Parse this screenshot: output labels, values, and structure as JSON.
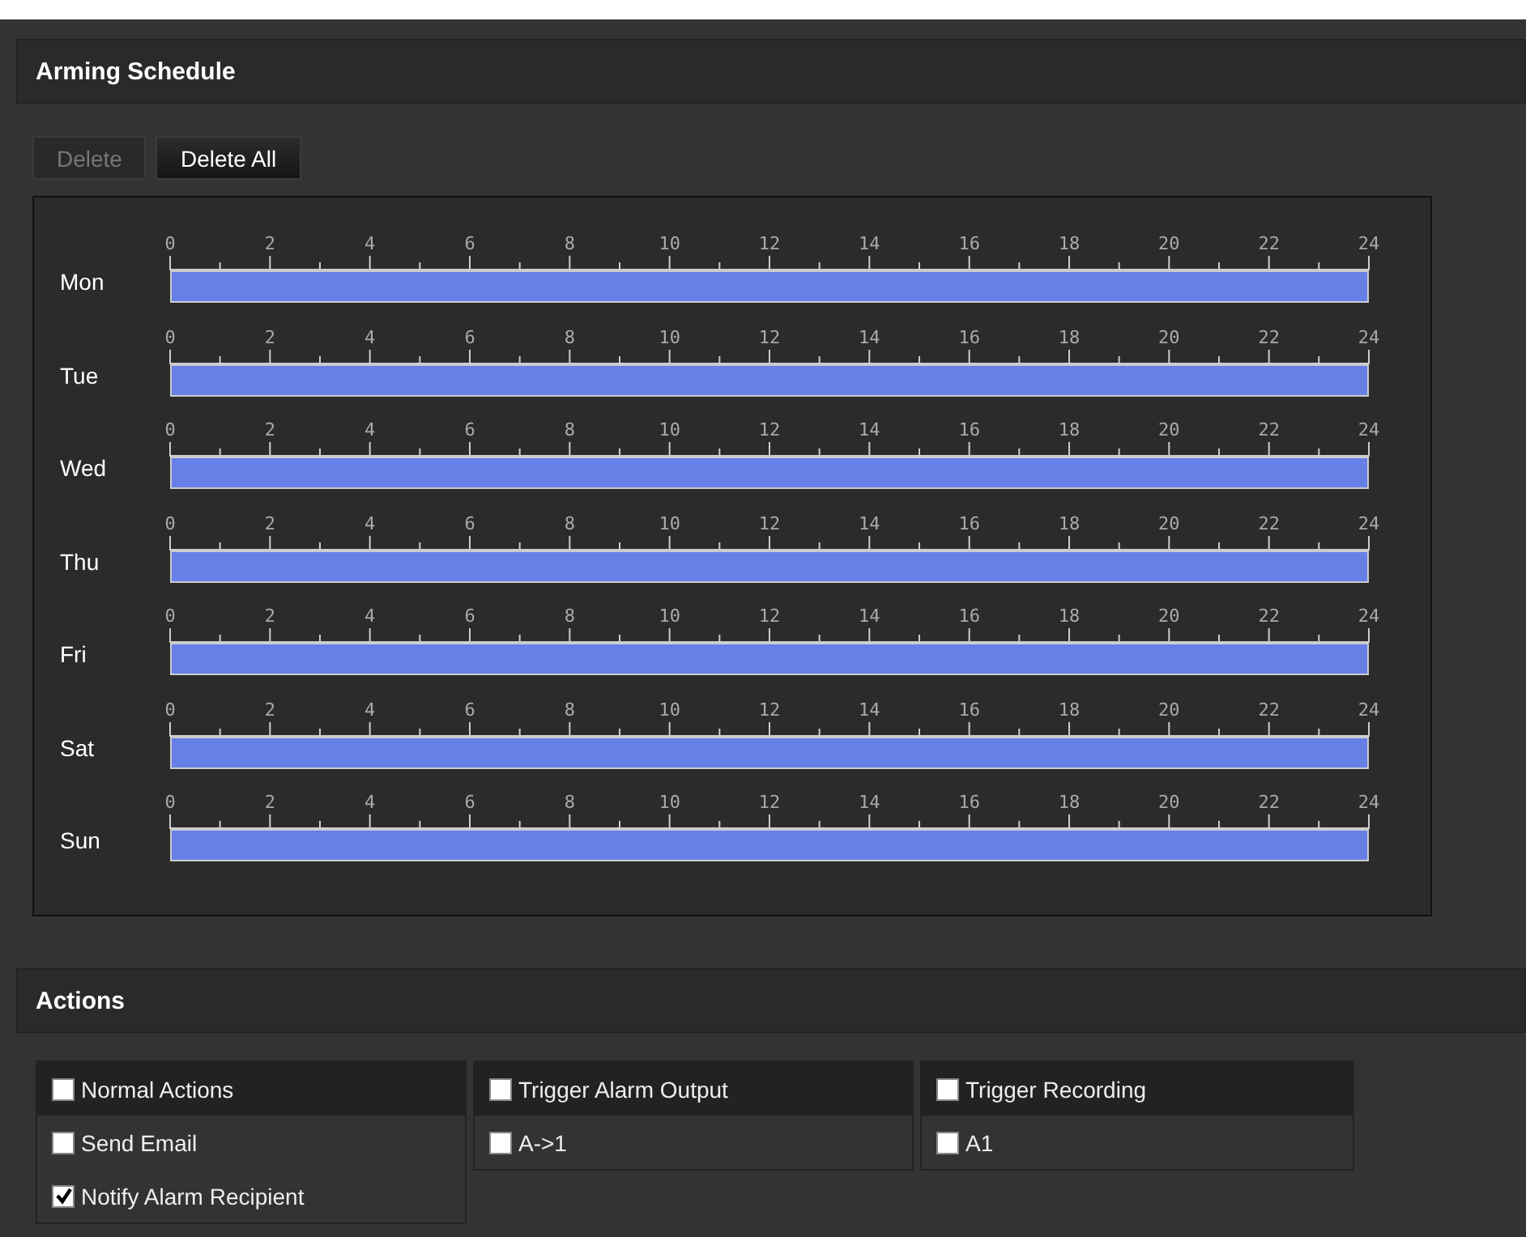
{
  "schedule": {
    "title": "Arming Schedule",
    "buttons": [
      {
        "label": "Delete",
        "disabled": true
      },
      {
        "label": "Delete All",
        "disabled": false
      }
    ],
    "days": [
      {
        "label": "Mon",
        "scale": [
          "0",
          "2",
          "4",
          "6",
          "8",
          "10",
          "12",
          "14",
          "16",
          "18",
          "20",
          "22",
          "24"
        ],
        "level": 1
      },
      {
        "label": "Tue",
        "scale": [
          "0",
          "2",
          "4",
          "6",
          "8",
          "10",
          "12",
          "14",
          "16",
          "18",
          "20",
          "22",
          "24"
        ],
        "level": 1
      },
      {
        "label": "Wed",
        "scale": [
          "0",
          "2",
          "4",
          "6",
          "8",
          "10",
          "12",
          "14",
          "16",
          "18",
          "20",
          "22",
          "24"
        ],
        "level": 1
      },
      {
        "label": "Thu",
        "scale": [
          "0",
          "2",
          "4",
          "6",
          "8",
          "10",
          "12",
          "14",
          "16",
          "18",
          "20",
          "22",
          "24"
        ],
        "level": 1
      },
      {
        "label": "Fri",
        "scale": [
          "0",
          "2",
          "4",
          "6",
          "8",
          "10",
          "12",
          "14",
          "16",
          "18",
          "20",
          "22",
          "24"
        ],
        "level": 1
      },
      {
        "label": "Sat",
        "scale": [
          "0",
          "2",
          "4",
          "6",
          "8",
          "10",
          "12",
          "14",
          "16",
          "18",
          "20",
          "22",
          "24"
        ],
        "level": 1
      },
      {
        "label": "Sun",
        "scale": [
          "0",
          "2",
          "4",
          "6",
          "8",
          "10",
          "12",
          "14",
          "16",
          "18",
          "20",
          "22",
          "24"
        ],
        "level": 1
      }
    ]
  },
  "actions": {
    "title": "Actions",
    "groups": [
      {
        "header": {
          "label": "Normal Actions",
          "checked": false
        },
        "items": [
          {
            "label": "Send Email",
            "checked": false
          },
          {
            "label": "Notify Alarm Recipient",
            "checked": true
          }
        ]
      },
      {
        "header": {
          "label": "Trigger Alarm Output",
          "checked": false
        },
        "items": [
          {
            "label": "A->1",
            "checked": false
          }
        ]
      },
      {
        "header": {
          "label": "Trigger Recording",
          "checked": false
        },
        "items": [
          {
            "label": "A1",
            "checked": false
          }
        ]
      }
    ]
  }
}
